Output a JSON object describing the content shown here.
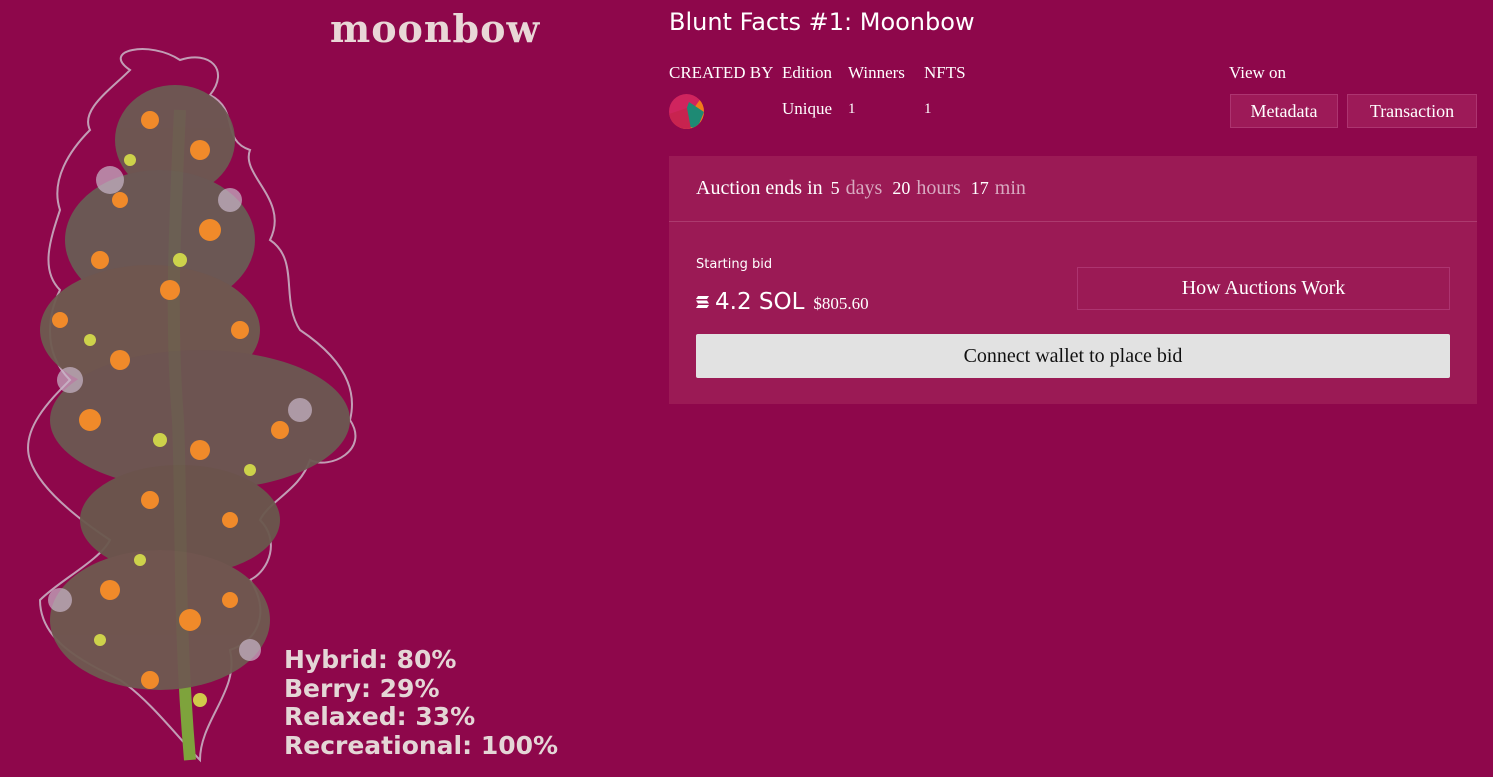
{
  "artwork": {
    "title": "moonbow",
    "traits": [
      "Hybrid: 80%",
      "Berry: 29%",
      "Relaxed: 33%",
      "Recreational: 100%"
    ]
  },
  "nft": {
    "title": "Blunt Facts #1: Moonbow"
  },
  "meta": {
    "created_by_label": "CREATED BY",
    "edition_label": "Edition",
    "winners_label": "Winners",
    "nfts_label": "NFTS",
    "edition_value": "Unique",
    "winners_value": "1",
    "nfts_value": "1",
    "view_on_label": "View on",
    "metadata_button": "Metadata",
    "transaction_button": "Transaction"
  },
  "auction": {
    "ends_label": "Auction ends in",
    "days_value": "5",
    "days_unit": "days",
    "hours_value": "20",
    "hours_unit": "hours",
    "min_value": "17",
    "min_unit": "min",
    "starting_bid_label": "Starting bid",
    "bid_sol": "4.2 SOL",
    "bid_usd": "$805.60",
    "how_auctions_button": "How Auctions Work",
    "connect_button": "Connect wallet to place bid"
  },
  "colors": {
    "background": "#8e074b",
    "panel": "#9b1a55",
    "connect_button": "#e2e2e2"
  },
  "icons": [
    "creator-avatar-icon",
    "solana-icon"
  ]
}
